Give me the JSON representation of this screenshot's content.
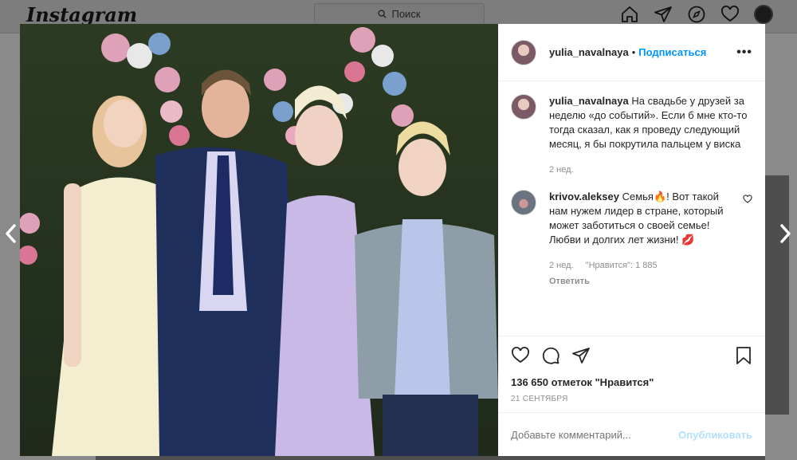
{
  "app": {
    "logo": "Instagram"
  },
  "search": {
    "placeholder": "Поиск"
  },
  "post": {
    "username": "yulia_navalnaya",
    "follow_label": "Подписаться",
    "separator": "•",
    "more_label": "•••",
    "caption": "На свадьбе у друзей за неделю «до событий». Если б мне кто-то тогда сказал, как я проведу следующий месяц, я бы покрутила пальцем у виска",
    "caption_time": "2 нед.",
    "comments": [
      {
        "username": "krivov.aleksey",
        "text": "Семья🔥! Вот такой нам нужем лидер в стране, который может заботиться о своей семье! Любви и долгих лет жизни! 💋",
        "time": "2 нед.",
        "likes": "\"Нравится\": 1 885",
        "reply_label": "Ответить"
      }
    ],
    "likes_text": "136 650 отметок \"Нравится\"",
    "date": "21 СЕНТЯБРЯ",
    "comment_placeholder": "Добавьте комментарий...",
    "publish_label": "Опубликовать"
  },
  "colors": {
    "accent": "#0095f6",
    "publish_disabled": "#b2dffc",
    "muted": "#8e8e8e"
  },
  "icons": [
    "home-icon",
    "direct-icon",
    "explore-icon",
    "heart-icon",
    "search-icon",
    "more-icon",
    "like-icon",
    "comment-icon",
    "share-icon",
    "bookmark-icon",
    "chevron-left-icon",
    "chevron-right-icon"
  ]
}
